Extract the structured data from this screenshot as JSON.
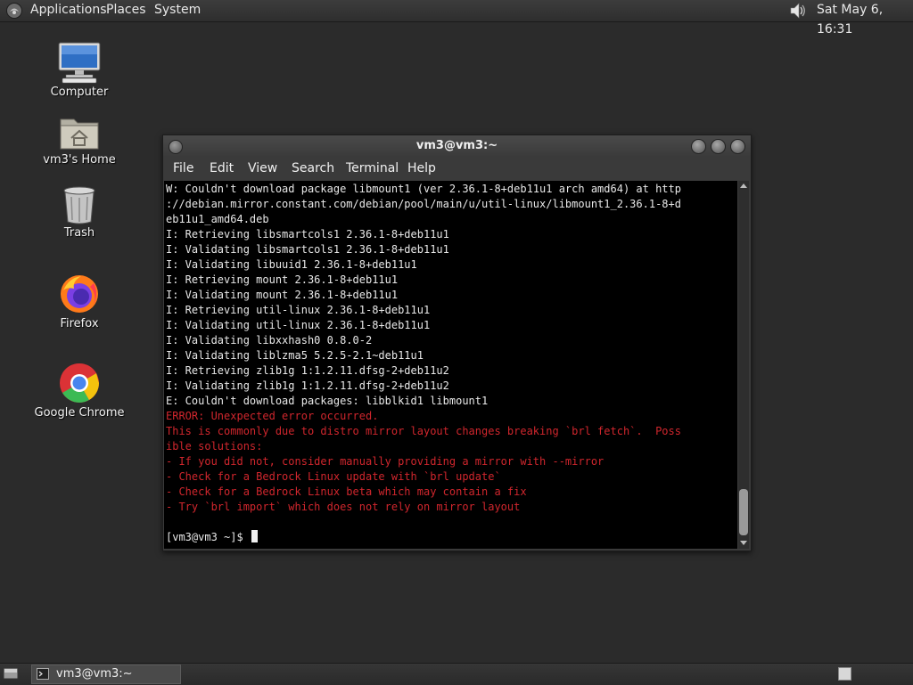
{
  "top_panel": {
    "menus": [
      "Applications",
      "Places",
      "System"
    ],
    "clock": "Sat May  6, 16:31"
  },
  "desktop": {
    "icons": [
      {
        "label": "Computer",
        "icon": "computer-icon"
      },
      {
        "label": "vm3's Home",
        "icon": "home-folder-icon"
      },
      {
        "label": "Trash",
        "icon": "trash-icon"
      },
      {
        "label": "Firefox",
        "icon": "firefox-icon"
      },
      {
        "label": "Google Chrome",
        "icon": "chrome-icon"
      }
    ]
  },
  "terminal": {
    "title": "vm3@vm3:~",
    "menus": [
      "File",
      "Edit",
      "View",
      "Search",
      "Terminal",
      "Help"
    ],
    "lines": [
      {
        "text": "W: Couldn't download package libmount1 (ver 2.36.1-8+deb11u1 arch amd64) at http",
        "style": "normal"
      },
      {
        "text": "://debian.mirror.constant.com/debian/pool/main/u/util-linux/libmount1_2.36.1-8+d",
        "style": "normal"
      },
      {
        "text": "eb11u1_amd64.deb",
        "style": "normal"
      },
      {
        "text": "I: Retrieving libsmartcols1 2.36.1-8+deb11u1",
        "style": "normal"
      },
      {
        "text": "I: Validating libsmartcols1 2.36.1-8+deb11u1",
        "style": "normal"
      },
      {
        "text": "I: Validating libuuid1 2.36.1-8+deb11u1",
        "style": "normal"
      },
      {
        "text": "I: Retrieving mount 2.36.1-8+deb11u1",
        "style": "normal"
      },
      {
        "text": "I: Validating mount 2.36.1-8+deb11u1",
        "style": "normal"
      },
      {
        "text": "I: Retrieving util-linux 2.36.1-8+deb11u1",
        "style": "normal"
      },
      {
        "text": "I: Validating util-linux 2.36.1-8+deb11u1",
        "style": "normal"
      },
      {
        "text": "I: Validating libxxhash0 0.8.0-2",
        "style": "normal"
      },
      {
        "text": "I: Validating liblzma5 5.2.5-2.1~deb11u1",
        "style": "normal"
      },
      {
        "text": "I: Retrieving zlib1g 1:1.2.11.dfsg-2+deb11u2",
        "style": "normal"
      },
      {
        "text": "I: Validating zlib1g 1:1.2.11.dfsg-2+deb11u2",
        "style": "normal"
      },
      {
        "text": "E: Couldn't download packages: libblkid1 libmount1",
        "style": "normal"
      },
      {
        "text": "ERROR: Unexpected error occurred.",
        "style": "error"
      },
      {
        "text": "This is commonly due to distro mirror layout changes breaking `brl fetch`.  Poss",
        "style": "error"
      },
      {
        "text": "ible solutions:",
        "style": "error"
      },
      {
        "text": "- If you did not, consider manually providing a mirror with --mirror",
        "style": "error"
      },
      {
        "text": "- Check for a Bedrock Linux update with `brl update`",
        "style": "error"
      },
      {
        "text": "- Check for a Bedrock Linux beta which may contain a fix",
        "style": "error"
      },
      {
        "text": "- Try `brl import` which does not rely on mirror layout",
        "style": "error"
      },
      {
        "text": "",
        "style": "normal"
      },
      {
        "text": "[vm3@vm3 ~]$ ",
        "style": "prompt"
      }
    ]
  },
  "bottom_panel": {
    "task_label": "vm3@vm3:~"
  },
  "colors": {
    "terminal_bg": "#000000",
    "terminal_fg": "#e8e8e8",
    "error_fg": "#d0262d",
    "desktop_bg": "#2b2b2b"
  }
}
